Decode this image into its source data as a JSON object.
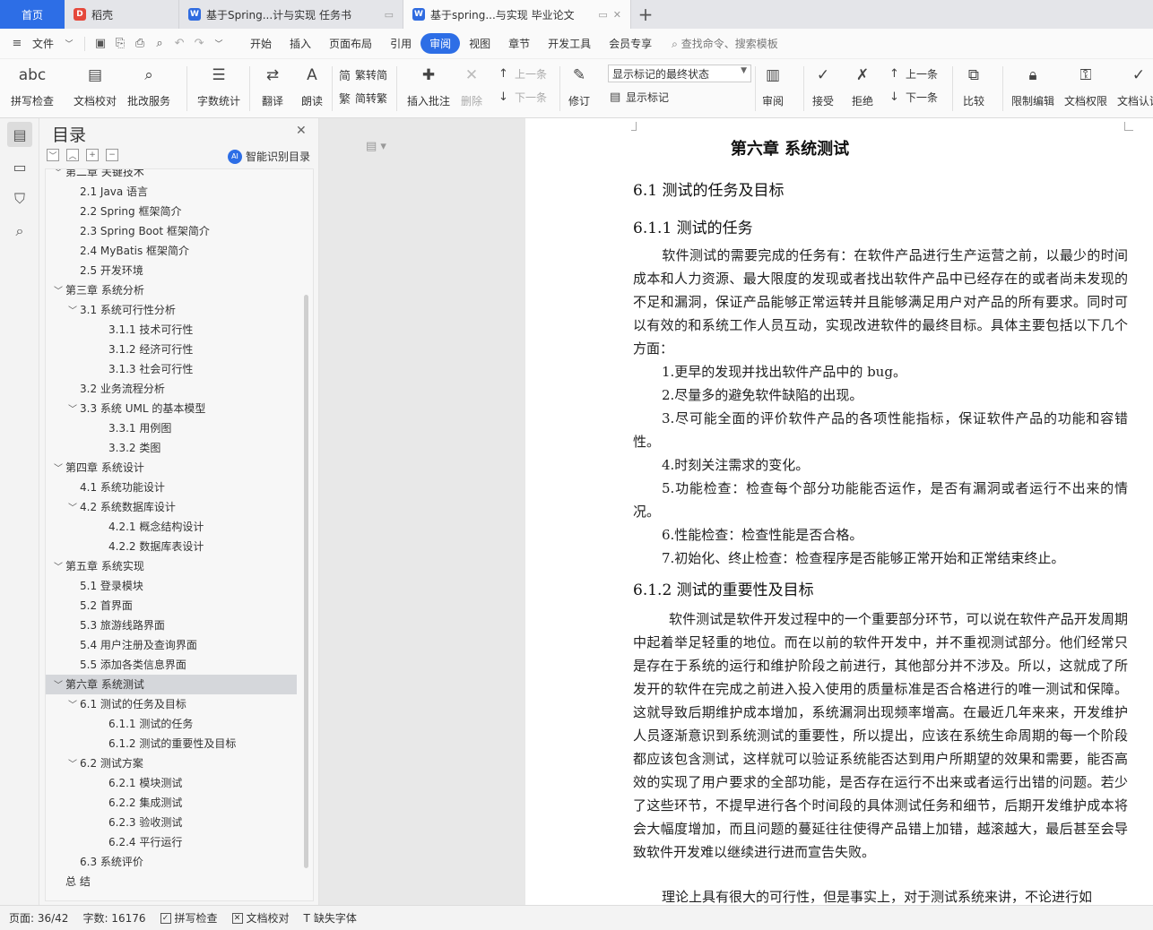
{
  "tabs": {
    "home": "首页",
    "wps": "稻壳",
    "doc1": "基于Spring...计与实现 任务书",
    "doc2": "基于spring...与实现 毕业论文",
    "add": "+"
  },
  "menubar": {
    "file": "文件",
    "tabs": [
      "开始",
      "插入",
      "页面布局",
      "引用",
      "审阅",
      "视图",
      "章节",
      "开发工具",
      "会员专享"
    ],
    "active_tab": "审阅",
    "search": "查找命令、搜索模板"
  },
  "ribbon": {
    "spell_check": "拼写检查",
    "doc_proofread": "文档校对",
    "annotate_service": "批改服务",
    "word_count": "字数统计",
    "translate": "翻译",
    "read_aloud": "朗读",
    "simp_to_trad": "繁转简",
    "trad_to_simp": "简转繁",
    "insert_comment": "插入批注",
    "delete": "删除",
    "prev_comment": "上一条",
    "next_comment": "下一条",
    "track_changes": "修订",
    "markup_select": "显示标记的最终状态",
    "show_markup": "显示标记",
    "review": "审阅",
    "accept": "接受",
    "reject": "拒绝",
    "prev_change": "上一条",
    "next_change": "下一条",
    "compare": "比较",
    "restrict_edit": "限制编辑",
    "doc_permission": "文档权限",
    "doc_cert": "文档认证"
  },
  "toc": {
    "title": "目录",
    "smart": "智能识别目录",
    "items": [
      {
        "text": "第二章  关键技术",
        "level": 1,
        "chev": "﹀"
      },
      {
        "text": "2.1 Java 语言",
        "level": 2,
        "chev": ""
      },
      {
        "text": "2.2 Spring 框架简介",
        "level": 2,
        "chev": ""
      },
      {
        "text": "2.3 Spring Boot 框架简介",
        "level": 2,
        "chev": ""
      },
      {
        "text": "2.4 MyBatis  框架简介",
        "level": 2,
        "chev": ""
      },
      {
        "text": "2.5  开发环境",
        "level": 2,
        "chev": ""
      },
      {
        "text": "第三章  系统分析",
        "level": 1,
        "chev": "﹀"
      },
      {
        "text": "3.1  系统可行性分析",
        "level": 2,
        "chev": "﹀"
      },
      {
        "text": "3.1.1  技术可行性",
        "level": 3,
        "chev": ""
      },
      {
        "text": "3.1.2  经济可行性",
        "level": 3,
        "chev": ""
      },
      {
        "text": "3.1.3  社会可行性",
        "level": 3,
        "chev": ""
      },
      {
        "text": "3.2  业务流程分析",
        "level": 2,
        "chev": ""
      },
      {
        "text": "3.3  系统 UML 的基本模型",
        "level": 2,
        "chev": "﹀"
      },
      {
        "text": "3.3.1  用例图",
        "level": 3,
        "chev": ""
      },
      {
        "text": "3.3.2  类图",
        "level": 3,
        "chev": ""
      },
      {
        "text": "第四章  系统设计",
        "level": 1,
        "chev": "﹀"
      },
      {
        "text": "4.1  系统功能设计",
        "level": 2,
        "chev": ""
      },
      {
        "text": "4.2  系统数据库设计",
        "level": 2,
        "chev": "﹀"
      },
      {
        "text": "4.2.1  概念结构设计",
        "level": 3,
        "chev": ""
      },
      {
        "text": "4.2.2  数据库表设计",
        "level": 3,
        "chev": ""
      },
      {
        "text": "第五章  系统实现",
        "level": 1,
        "chev": "﹀"
      },
      {
        "text": "5.1  登录模块",
        "level": 2,
        "chev": ""
      },
      {
        "text": "5.2  首界面",
        "level": 2,
        "chev": ""
      },
      {
        "text": "5.3  旅游线路界面",
        "level": 2,
        "chev": ""
      },
      {
        "text": "5.4  用户注册及查询界面",
        "level": 2,
        "chev": ""
      },
      {
        "text": "5.5  添加各类信息界面",
        "level": 2,
        "chev": ""
      },
      {
        "text": "第六章  系统测试",
        "level": 1,
        "chev": "﹀",
        "selected": true
      },
      {
        "text": "6.1 测试的任务及目标",
        "level": 2,
        "chev": "﹀"
      },
      {
        "text": "6.1.1 测试的任务",
        "level": 3,
        "chev": ""
      },
      {
        "text": "6.1.2 测试的重要性及目标",
        "level": 3,
        "chev": ""
      },
      {
        "text": "6.2 测试方案",
        "level": 2,
        "chev": "﹀"
      },
      {
        "text": "6.2.1 模块测试",
        "level": 3,
        "chev": ""
      },
      {
        "text": "6.2.2 集成测试",
        "level": 3,
        "chev": ""
      },
      {
        "text": "6.2.3 验收测试",
        "level": 3,
        "chev": ""
      },
      {
        "text": "6.2.4 平行运行",
        "level": 3,
        "chev": ""
      },
      {
        "text": "6.3 系统评价",
        "level": 2,
        "chev": ""
      },
      {
        "text": "总    结",
        "level": 1,
        "chev": ""
      }
    ]
  },
  "document": {
    "chapter_title": "第六章  系统测试",
    "h_6_1": "6.1 测试的任务及目标",
    "h_6_1_1": "6.1.1 测试的任务",
    "p1": "软件测试的需要完成的任务有：在软件产品进行生产运营之前，以最少的时间成本和人力资源、最大限度的发现或者找出软件产品中已经存在的或者尚未发现的不足和漏洞，保证产品能够正常运转并且能够满足用户对产品的所有要求。同时可以有效的和系统工作人员互动，实现改进软件的最终目标。具体主要包括以下几个方面：",
    "l1": "1.更早的发现并找出软件产品中的 bug。",
    "l2": "2.尽量多的避免软件缺陷的出现。",
    "l3": "3.尽可能全面的评价软件产品的各项性能指标，保证软件产品的功能和容错性。",
    "l4": "4.时刻关注需求的变化。",
    "l5": "5.功能检查：检查每个部分功能能否运作，是否有漏洞或者运行不出来的情况。",
    "l6": "6.性能检查：检查性能是否合格。",
    "l7": "7.初始化、终止检查：检查程序是否能够正常开始和正常结束终止。",
    "h_6_1_2": "6.1.2 测试的重要性及目标",
    "p2": "软件测试是软件开发过程中的一个重要部分环节，可以说在软件产品开发周期中起着举足轻重的地位。而在以前的软件开发中，并不重视测试部分。他们经常只是存在于系统的运行和维护阶段之前进行，其他部分并不涉及。所以，这就成了所发开的软件在完成之前进入投入使用的质量标准是否合格进行的唯一测试和保障。这就导致后期维护成本增加，系统漏洞出现频率增高。在最近几年来来，开发维护人员逐渐意识到系统测试的重要性，所以提出，应该在系统生命周期的每一个阶段都应该包含测试，这样就可以验证系统能否达到用户所期望的效果和需要，能否高效的实现了用户要求的全部功能，是否存在运行不出来或者运行出错的问题。若少了这些环节，不提早进行各个时间段的具体测试任务和细节，后期开发维护成本将会大幅度增加，而且问题的蔓延往往使得产品错上加错，越滚越大，最后甚至会导致软件开发难以继续进行进而宣告失败。",
    "p3": "理论上具有很大的可行性，但是事实上，对于测试系统来讲，不论进行如"
  },
  "status": {
    "page": "页面: 36/42",
    "words": "字数: 16176",
    "spell": "拼写检查",
    "proof": "文档校对",
    "missing_font": "缺失字体"
  }
}
